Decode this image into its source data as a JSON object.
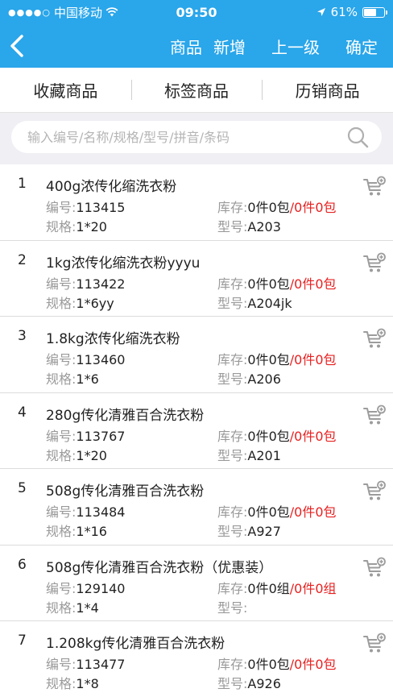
{
  "status_bar": {
    "carrier": "中国移动",
    "signal_dots": "●●●●○",
    "time": "09:50",
    "battery_pct": "61%",
    "battery_level": 0.61
  },
  "nav": {
    "back_icon": "chevron-left-icon",
    "actions": [
      "商品",
      "新增",
      "上一级",
      "确定"
    ]
  },
  "tabs": [
    "收藏商品",
    "标签商品",
    "历销商品"
  ],
  "search": {
    "placeholder": "输入编号/名称/规格/型号/拼音/条码",
    "value": ""
  },
  "labels": {
    "code": "编号:",
    "stock": "库存:",
    "spec": "规格:",
    "model": "型号:"
  },
  "colors": {
    "brand": "#2aa6ea",
    "stock_red": "#e82020",
    "label_gray": "#9a9a9a"
  },
  "items": [
    {
      "index": "1",
      "name": "400g浓传化缩洗衣粉",
      "code": "113415",
      "stock": "0件0包",
      "stock_alt": "/0件0包",
      "spec": "1*20",
      "model": "A203"
    },
    {
      "index": "2",
      "name": "1kg浓传化缩洗衣粉yyyu",
      "code": "113422",
      "stock": "0件0包",
      "stock_alt": "/0件0包",
      "spec": "1*6yy",
      "model": "A204jk"
    },
    {
      "index": "3",
      "name": "1.8kg浓传化缩洗衣粉",
      "code": "113460",
      "stock": "0件0包",
      "stock_alt": "/0件0包",
      "spec": "1*6",
      "model": "A206"
    },
    {
      "index": "4",
      "name": "280g传化清雅百合洗衣粉",
      "code": "113767",
      "stock": "0件0包",
      "stock_alt": "/0件0包",
      "spec": "1*20",
      "model": "A201"
    },
    {
      "index": "5",
      "name": "508g传化清雅百合洗衣粉",
      "code": "113484",
      "stock": "0件0包",
      "stock_alt": "/0件0包",
      "spec": "1*16",
      "model": "A927"
    },
    {
      "index": "6",
      "name": "508g传化清雅百合洗衣粉（优惠装）",
      "code": "129140",
      "stock": "0件0组",
      "stock_alt": "/0件0组",
      "spec": "1*4",
      "model": ""
    },
    {
      "index": "7",
      "name": "1.208kg传化清雅百合洗衣粉",
      "code": "113477",
      "stock": "0件0包",
      "stock_alt": "/0件0包",
      "spec": "1*8",
      "model": "A926"
    }
  ]
}
